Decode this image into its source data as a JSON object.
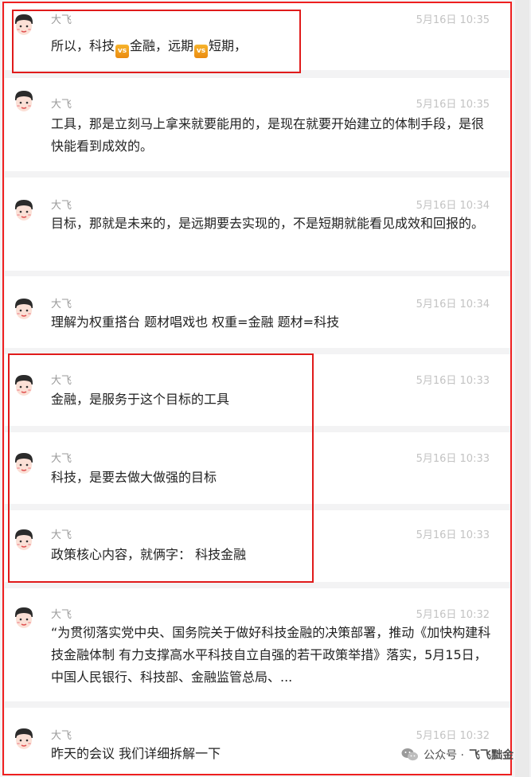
{
  "messages": [
    {
      "name": "大飞",
      "time": "5月16日 10:35",
      "parts": [
        "所以，科技",
        "金融，远期",
        "短期，"
      ],
      "badge": "vs"
    },
    {
      "name": "大飞",
      "time": "5月16日 10:35",
      "text": "工具，那是立刻马上拿来就要能用的，是现在就要开始建立的体制手段，是很快能看到成效的。"
    },
    {
      "name": "大飞",
      "time": "5月16日 10:34",
      "text": "目标，那就是未来的，是远期要去实现的，不是短期就能看见成效和回报的。"
    },
    {
      "name": "大飞",
      "time": "5月16日 10:34",
      "text": "理解为权重搭台 题材唱戏也 权重=金融 题材=科技"
    },
    {
      "name": "大飞",
      "time": "5月16日 10:33",
      "text": "金融，是服务于这个目标的工具"
    },
    {
      "name": "大飞",
      "time": "5月16日 10:33",
      "text": "科技，是要去做大做强的目标"
    },
    {
      "name": "大飞",
      "time": "5月16日 10:33",
      "text": "政策核心内容，就俩字：  科技金融"
    },
    {
      "name": "大飞",
      "time": "5月16日 10:32",
      "text": "“为贯彻落实党中央、国务院关于做好科技金融的决策部署，推动《加快构建科技金融体制 有力支撑高水平科技自立自强的若干政策举措》落实，5月15日，中国人民银行、科技部、金融监管总局、..."
    },
    {
      "name": "大飞",
      "time": "5月16日 10:32",
      "text": "昨天的会议 我们详细拆解一下"
    }
  ],
  "watermark": {
    "prefix": "公众号 · ",
    "name": "飞飞黜金",
    "icon": "wechat-icon"
  },
  "colors": {
    "highlight_box": "#e01b1b",
    "background": "#f3f3f4",
    "card": "#ffffff"
  }
}
